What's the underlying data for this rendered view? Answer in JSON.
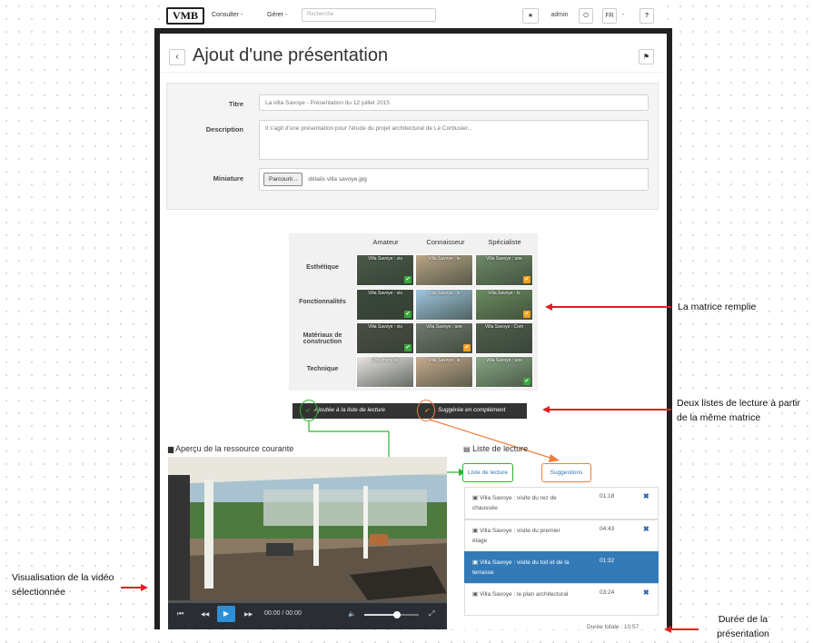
{
  "navbar": {
    "logo": "VMB",
    "menu_consulter": "Consulter -",
    "menu_gerer": "Gérer -",
    "search_placeholder": "Recherche",
    "star_icon": "★",
    "user": "admin",
    "power_icon": "⏻",
    "lang": "FR",
    "lang_caret": "-",
    "help_icon": "?"
  },
  "header": {
    "back_icon": "‹",
    "title": "Ajout d'une présentation",
    "bookmark_icon": "⚑"
  },
  "form": {
    "title_label": "Titre",
    "title_value": "La villa Savoye - Présentation du 12 juillet 2015",
    "description_label": "Description",
    "description_value": "Il s'agit d'une présentation pour l'étude du projet architectural de Le Corbusier...",
    "thumbnail_label": "Miniature",
    "browse_button": "Parcourir...",
    "thumbnail_file": "détails villa savoye.jpg"
  },
  "matrix": {
    "columns": [
      "Amateur",
      "Connaisseur",
      "Spécialiste"
    ],
    "rows": [
      {
        "label": "Esthétique",
        "cells": [
          {
            "label": "Villa Savoye : vis",
            "check": "green",
            "tone": "#4a5a4a"
          },
          {
            "label": "Villa Savoye : le",
            "check": "",
            "tone": "#b9a585"
          },
          {
            "label": "Villa Savoye : une",
            "check": "orange",
            "tone": "#6f8a68"
          }
        ]
      },
      {
        "label": "Fonctionnalités",
        "cells": [
          {
            "label": "Villa Savoye : vis",
            "check": "green",
            "tone": "#3c4a3c"
          },
          {
            "label": "Villa Savoye : le",
            "check": "",
            "tone": "#9fc6df"
          },
          {
            "label": "Villa Savoye : le",
            "check": "orange",
            "tone": "#6b8c5e"
          }
        ]
      },
      {
        "label": "Matériaux de construction",
        "cells": [
          {
            "label": "Villa Savoye : vis",
            "check": "green",
            "tone": "#4b4f45"
          },
          {
            "label": "Villa Savoye : une",
            "check": "orange",
            "tone": "#707a6e"
          },
          {
            "label": "Villa Savoye : Com",
            "check": "",
            "tone": "#52604f"
          }
        ]
      },
      {
        "label": "Technique",
        "cells": [
          {
            "label": "Document de",
            "check": "",
            "tone": "#e9e5e3"
          },
          {
            "label": "Villa Savoye : le",
            "check": "",
            "tone": "#c8ab8e"
          },
          {
            "label": "Villa Savoye : une",
            "check": "green",
            "tone": "#89a784"
          }
        ]
      }
    ]
  },
  "legend": {
    "added_check": "✔",
    "added_label": "Ajoutée à la liste de lecture",
    "suggested_check": "✔",
    "suggested_label": "Suggérée en complément"
  },
  "preview": {
    "title": "Aperçu de la ressource courante",
    "time": "00:00 / 00:00",
    "prev_icon": "⏮",
    "rewind_icon": "◀◀",
    "play_icon": "▶",
    "forward_icon": "▶▶",
    "volume_icon": "🔈",
    "fullscreen_icon": "⤢",
    "volume_level": 0.6
  },
  "playlist": {
    "title": "Liste de lecture",
    "tab_playlist": "Liste de lecture",
    "tab_suggestions": "Suggestions",
    "items": [
      {
        "title": "Villa Savoye : visite du rez de chaussée",
        "duration": "01:18",
        "active": false,
        "remove": "✖"
      },
      {
        "title": "Villa Savoye : visite du premier étage",
        "duration": "04:43",
        "active": false,
        "remove": "✖"
      },
      {
        "title": "Villa Savoye : visite du toit et de la terrasse",
        "duration": "01:32",
        "active": true,
        "remove": ""
      },
      {
        "title": "Villa Savoye : le plan architectural",
        "duration": "03:24",
        "active": false,
        "remove": "✖"
      }
    ],
    "total_duration": "Durée totale : 10:57"
  },
  "annotations": {
    "matrix": "La matrice remplie",
    "lists": "Deux listes de lecture à partir de la même matrice",
    "video": "Visualisation de la vidéo sélectionnée",
    "duration": "Durée de la présentation"
  }
}
